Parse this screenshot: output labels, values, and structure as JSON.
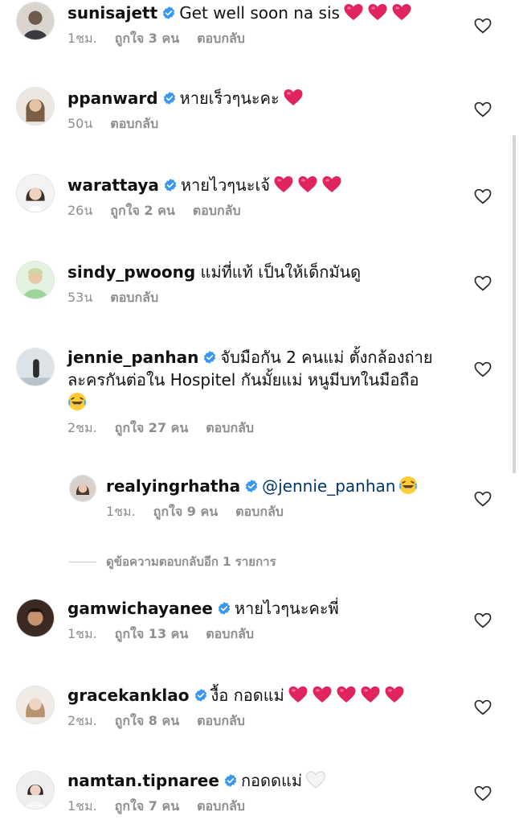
{
  "comments": [
    {
      "user": "sunisajett",
      "verified": true,
      "text": "Get well soon na sis",
      "hearts": 3,
      "time": "1ชม.",
      "likes": "ถูกใจ 3 คน",
      "reply": "ตอบกลับ"
    },
    {
      "user": "ppanward",
      "verified": true,
      "text": "หายเร็วๆนะคะ",
      "hearts": 1,
      "time": "50น",
      "likes": "",
      "reply": "ตอบกลับ"
    },
    {
      "user": "warattaya",
      "verified": true,
      "text": "หายไวๆนะเจ้",
      "hearts": 3,
      "time": "26น",
      "likes": "ถูกใจ 2 คน",
      "reply": "ตอบกลับ"
    },
    {
      "user": "sindy_pwoong",
      "verified": false,
      "text": "แม่ที่แท้ เป็นให้เด็กมันดู",
      "hearts": 0,
      "time": "53น",
      "likes": "",
      "reply": "ตอบกลับ"
    },
    {
      "user": "jennie_panhan",
      "verified": true,
      "text_line1": "จับมือกัน 2 คนแม่ ตั้งกล้องถ่าย",
      "text_line2": "ละครกันต่อใน Hospitel กันมั้ยแม่ หนูมีบทในมือถือ",
      "time": "2ชม.",
      "likes": "ถูกใจ 27 คน",
      "reply": "ตอบกลับ"
    },
    {
      "user": "realyingrhatha",
      "verified": true,
      "mention": "@jennie_panhan",
      "time": "1ชม.",
      "likes": "ถูกใจ 9 คน",
      "reply": "ตอบกลับ"
    },
    {
      "user": "gamwichayanee",
      "verified": true,
      "text": "หายไวๆนะคะพี่",
      "hearts": 0,
      "time": "1ชม.",
      "likes": "ถูกใจ 13 คน",
      "reply": "ตอบกลับ"
    },
    {
      "user": "gracekanklao",
      "verified": true,
      "text": "งื้อ กอดแม่",
      "hearts": 5,
      "time": "2ชม.",
      "likes": "ถูกใจ 8 คน",
      "reply": "ตอบกลับ"
    },
    {
      "user": "namtan.tipnaree",
      "verified": true,
      "text": "กอดดแม่",
      "time": "1ชม.",
      "likes": "ถูกใจ 7 คน",
      "reply": "ตอบกลับ"
    }
  ],
  "view_more_replies": "ดูข้อความตอบกลับอีก 1 รายการ",
  "colors": {
    "verified": "#3897f0",
    "heart_emoji": "#e0245e",
    "meta": "#8e8e8e",
    "mention": "#00376b"
  },
  "icons": {
    "verified": "verified-badge-icon",
    "like": "heart-outline-icon",
    "red_heart": "red-heart-emoji",
    "white_heart": "white-heart-emoji",
    "laugh": "tears-of-joy-emoji"
  }
}
